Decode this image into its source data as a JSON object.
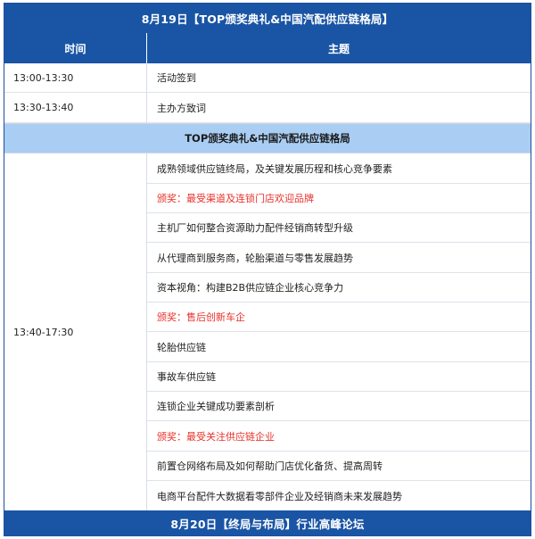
{
  "title_banner": "8月19日【TOP颁奖典礼&中国汽配供应链格局】",
  "columns": {
    "time": "时间",
    "topic": "主题"
  },
  "opening_rows": [
    {
      "time": "13:00-13:30",
      "topic": "活动签到"
    },
    {
      "time": "13:30-13:40",
      "topic": "主办方致词"
    }
  ],
  "section_banner": "TOP颁奖典礼&中国汽配供应链格局",
  "main_block": {
    "time": "13:40-17:30",
    "items": [
      {
        "text": "成熟领域供应链终局，及关键发展历程和核心竞争要素",
        "award": false
      },
      {
        "text": "颁奖：最受渠道及连锁门店欢迎品牌",
        "award": true
      },
      {
        "text": "主机厂如何整合资源助力配件经销商转型升级",
        "award": false
      },
      {
        "text": "从代理商到服务商，轮胎渠道与零售发展趋势",
        "award": false
      },
      {
        "text": "资本视角：构建B2B供应链企业核心竞争力",
        "award": false
      },
      {
        "text": "颁奖：售后创新车企",
        "award": true
      },
      {
        "text": "轮胎供应链",
        "award": false
      },
      {
        "text": "事故车供应链",
        "award": false
      },
      {
        "text": "连锁企业关键成功要素剖析",
        "award": false
      },
      {
        "text": "颁奖：最受关注供应链企业",
        "award": true
      },
      {
        "text": "前置仓网络布局及如何帮助门店优化备货、提高周转",
        "award": false
      },
      {
        "text": "电商平台配件大数据看零部件企业及经销商未来发展趋势",
        "award": false
      }
    ]
  },
  "footer_banner": "8月20日【终局与布局】行业高峰论坛",
  "colors": {
    "header_blue": "#1a55a5",
    "sub_banner": "#a9cdf3",
    "award_red": "#e8322b"
  }
}
